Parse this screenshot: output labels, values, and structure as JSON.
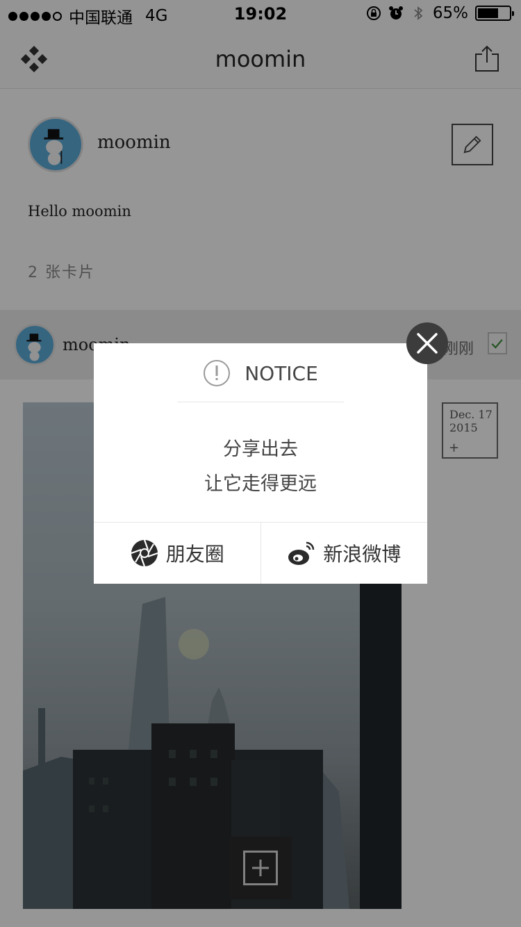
{
  "status_bar": {
    "carrier": "中国联通",
    "network": "4G",
    "time": "19:02",
    "battery_percent": "65%",
    "battery_level": 0.65,
    "signal_bars_filled": 4,
    "signal_bars_total": 5
  },
  "nav": {
    "title": "moomin",
    "left_icon": "menu-diamond-icon",
    "right_icon": "share-icon"
  },
  "profile": {
    "name": "moomin",
    "bio": "Hello moomin",
    "card_count": "2  张卡片",
    "edit_icon": "pencil-icon"
  },
  "feed": {
    "author": "moomin",
    "time": "刚刚",
    "date_stamp_line1": "Dec. 17",
    "date_stamp_line2": "2015",
    "date_stamp_plus": "+"
  },
  "dialog": {
    "title": "NOTICE",
    "message_line1": "分享出去",
    "message_line2": "让它走得更远",
    "buttons": [
      {
        "label": "朋友圈",
        "icon": "wechat-moments-icon"
      },
      {
        "label": "新浪微博",
        "icon": "weibo-icon"
      }
    ],
    "close_icon": "close-icon"
  },
  "colors": {
    "overlay": "#000000",
    "dialog_bg": "#ffffff",
    "close_bg": "#3c3c3c",
    "avatar_bg": "#5aa9d6"
  }
}
